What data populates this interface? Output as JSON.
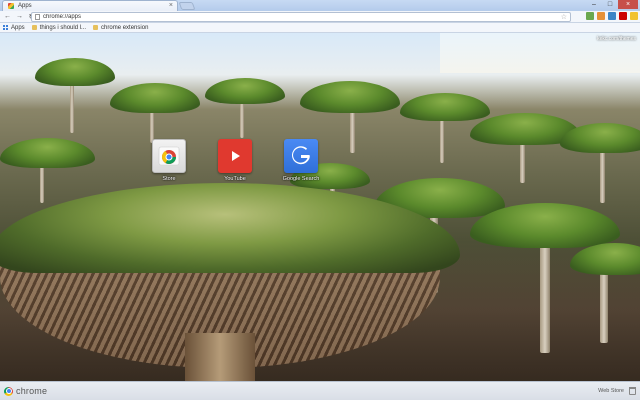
{
  "tab": {
    "title": "Apps",
    "close_glyph": "×"
  },
  "window_controls": {
    "minimize": "–",
    "maximize": "□",
    "close": "×"
  },
  "toolbar": {
    "back_glyph": "←",
    "forward_glyph": "→",
    "reload_glyph": "↻",
    "url": "chrome://apps",
    "star_glyph": "☆"
  },
  "bookmarks": [
    {
      "label": "Apps",
      "icon": "apps-grid-icon"
    },
    {
      "label": "things i should l...",
      "icon": "folder-icon"
    },
    {
      "label": "chrome extension",
      "icon": "folder-icon"
    }
  ],
  "extensions": [
    {
      "icon": "extension-icon",
      "color": "#6aa84f"
    },
    {
      "icon": "extension-icon",
      "color": "#e69138"
    },
    {
      "icon": "extension-icon",
      "color": "#3d85c6"
    },
    {
      "icon": "extension-icon",
      "color": "#cc0000"
    },
    {
      "icon": "extension-icon",
      "color": "#f1c232"
    },
    {
      "icon": "extension-icon",
      "color": "#674ea7"
    }
  ],
  "apps": [
    {
      "label": "Store",
      "icon": "chrome-web-store-icon"
    },
    {
      "label": "YouTube",
      "icon": "youtube-icon"
    },
    {
      "label": "Google Search",
      "icon": "google-search-icon"
    }
  ],
  "attribution": "kekc.com/themes",
  "bottom": {
    "brand": "chrome",
    "webstore": "Web Store"
  }
}
